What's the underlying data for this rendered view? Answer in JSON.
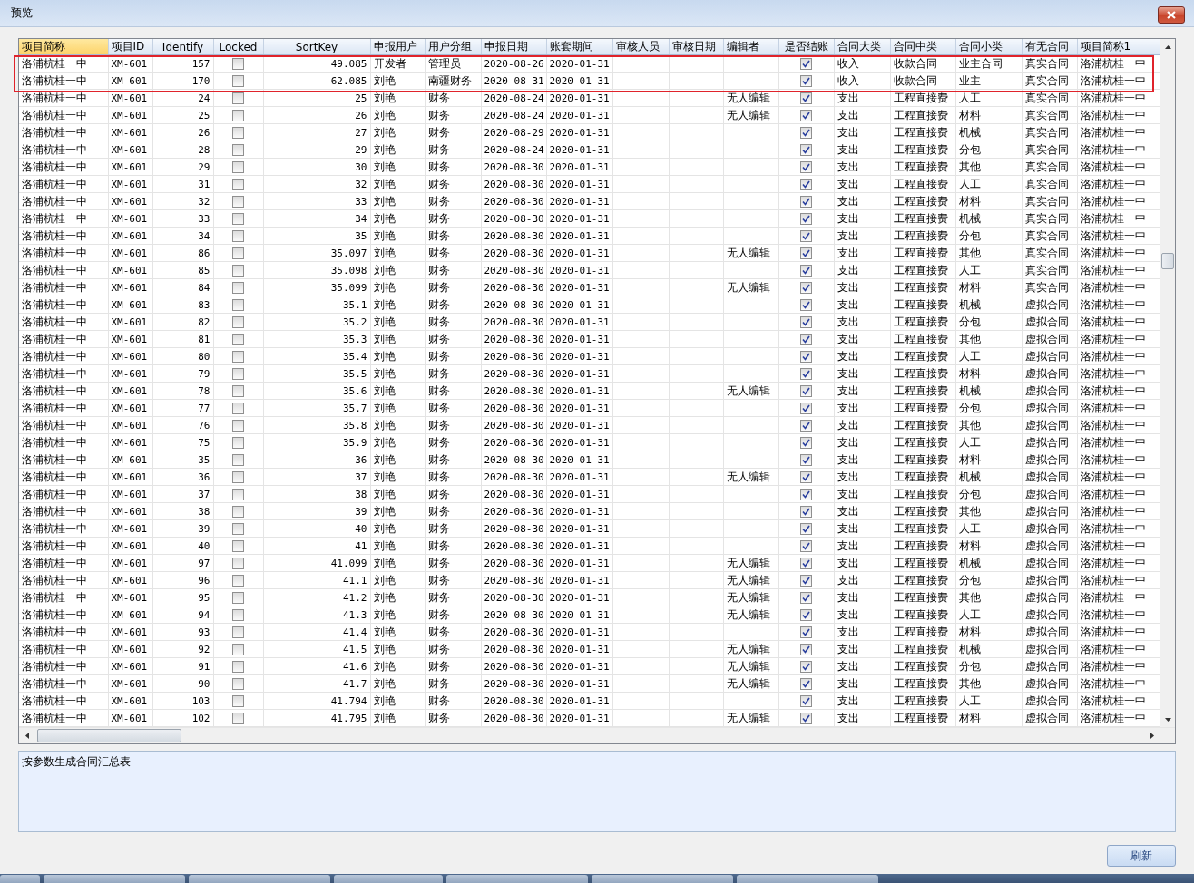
{
  "window": {
    "title": "预览"
  },
  "table": {
    "columns": [
      {
        "label": "项目简称",
        "kind": "text",
        "selected": true
      },
      {
        "label": "项目ID",
        "kind": "code",
        "selected": false
      },
      {
        "label": "Identify",
        "kind": "num",
        "selected": false
      },
      {
        "label": "Locked",
        "kind": "check",
        "selected": false
      },
      {
        "label": "SortKey",
        "kind": "num",
        "selected": false
      },
      {
        "label": "申报用户",
        "kind": "text",
        "selected": false
      },
      {
        "label": "用户分组",
        "kind": "text",
        "selected": false
      },
      {
        "label": "申报日期",
        "kind": "code",
        "selected": false
      },
      {
        "label": "账套期间",
        "kind": "code",
        "selected": false
      },
      {
        "label": "审核人员",
        "kind": "text",
        "selected": false
      },
      {
        "label": "审核日期",
        "kind": "text",
        "selected": false
      },
      {
        "label": "编辑者",
        "kind": "text",
        "selected": false
      },
      {
        "label": "是否结账",
        "kind": "check",
        "selected": false
      },
      {
        "label": "合同大类",
        "kind": "text",
        "selected": false
      },
      {
        "label": "合同中类",
        "kind": "text",
        "selected": false
      },
      {
        "label": "合同小类",
        "kind": "text",
        "selected": false
      },
      {
        "label": "有无合同",
        "kind": "text",
        "selected": false
      },
      {
        "label": "项目简称1",
        "kind": "text",
        "selected": false
      }
    ],
    "rows": [
      {
        "highlighted": true,
        "cells": [
          "洛浦杭桂一中",
          "XM-601",
          "157",
          false,
          "49.085",
          "开发者",
          "管理员",
          "2020-08-26",
          "2020-01-31",
          null,
          null,
          null,
          true,
          "收入",
          "收款合同",
          "业主合同",
          "真实合同",
          "洛浦杭桂一中"
        ]
      },
      {
        "highlighted": true,
        "cells": [
          "洛浦杭桂一中",
          "XM-601",
          "170",
          false,
          "62.085",
          "刘艳",
          "南疆财务",
          "2020-08-31",
          "2020-01-31",
          null,
          null,
          null,
          true,
          "收入",
          "收款合同",
          "业主",
          "真实合同",
          "洛浦杭桂一中"
        ]
      },
      {
        "highlighted": false,
        "cells": [
          "洛浦杭桂一中",
          "XM-601",
          "24",
          false,
          "25",
          "刘艳",
          "财务",
          "2020-08-24",
          "2020-01-31",
          null,
          null,
          "无人编辑",
          true,
          "支出",
          "工程直接费",
          "人工",
          "真实合同",
          "洛浦杭桂一中"
        ]
      },
      {
        "highlighted": false,
        "cells": [
          "洛浦杭桂一中",
          "XM-601",
          "25",
          false,
          "26",
          "刘艳",
          "财务",
          "2020-08-24",
          "2020-01-31",
          null,
          null,
          "无人编辑",
          true,
          "支出",
          "工程直接费",
          "材料",
          "真实合同",
          "洛浦杭桂一中"
        ]
      },
      {
        "highlighted": false,
        "cells": [
          "洛浦杭桂一中",
          "XM-601",
          "26",
          false,
          "27",
          "刘艳",
          "财务",
          "2020-08-29",
          "2020-01-31",
          null,
          null,
          null,
          true,
          "支出",
          "工程直接费",
          "机械",
          "真实合同",
          "洛浦杭桂一中"
        ]
      },
      {
        "highlighted": false,
        "cells": [
          "洛浦杭桂一中",
          "XM-601",
          "28",
          false,
          "29",
          "刘艳",
          "财务",
          "2020-08-24",
          "2020-01-31",
          null,
          null,
          null,
          true,
          "支出",
          "工程直接费",
          "分包",
          "真实合同",
          "洛浦杭桂一中"
        ]
      },
      {
        "highlighted": false,
        "cells": [
          "洛浦杭桂一中",
          "XM-601",
          "29",
          false,
          "30",
          "刘艳",
          "财务",
          "2020-08-30",
          "2020-01-31",
          null,
          null,
          null,
          true,
          "支出",
          "工程直接费",
          "其他",
          "真实合同",
          "洛浦杭桂一中"
        ]
      },
      {
        "highlighted": false,
        "cells": [
          "洛浦杭桂一中",
          "XM-601",
          "31",
          false,
          "32",
          "刘艳",
          "财务",
          "2020-08-30",
          "2020-01-31",
          null,
          null,
          null,
          true,
          "支出",
          "工程直接费",
          "人工",
          "真实合同",
          "洛浦杭桂一中"
        ]
      },
      {
        "highlighted": false,
        "cells": [
          "洛浦杭桂一中",
          "XM-601",
          "32",
          false,
          "33",
          "刘艳",
          "财务",
          "2020-08-30",
          "2020-01-31",
          null,
          null,
          null,
          true,
          "支出",
          "工程直接费",
          "材料",
          "真实合同",
          "洛浦杭桂一中"
        ]
      },
      {
        "highlighted": false,
        "cells": [
          "洛浦杭桂一中",
          "XM-601",
          "33",
          false,
          "34",
          "刘艳",
          "财务",
          "2020-08-30",
          "2020-01-31",
          null,
          null,
          null,
          true,
          "支出",
          "工程直接费",
          "机械",
          "真实合同",
          "洛浦杭桂一中"
        ]
      },
      {
        "highlighted": false,
        "cells": [
          "洛浦杭桂一中",
          "XM-601",
          "34",
          false,
          "35",
          "刘艳",
          "财务",
          "2020-08-30",
          "2020-01-31",
          null,
          null,
          null,
          true,
          "支出",
          "工程直接费",
          "分包",
          "真实合同",
          "洛浦杭桂一中"
        ]
      },
      {
        "highlighted": false,
        "cells": [
          "洛浦杭桂一中",
          "XM-601",
          "86",
          false,
          "35.097",
          "刘艳",
          "财务",
          "2020-08-30",
          "2020-01-31",
          null,
          null,
          "无人编辑",
          true,
          "支出",
          "工程直接费",
          "其他",
          "真实合同",
          "洛浦杭桂一中"
        ]
      },
      {
        "highlighted": false,
        "cells": [
          "洛浦杭桂一中",
          "XM-601",
          "85",
          false,
          "35.098",
          "刘艳",
          "财务",
          "2020-08-30",
          "2020-01-31",
          null,
          null,
          null,
          true,
          "支出",
          "工程直接费",
          "人工",
          "真实合同",
          "洛浦杭桂一中"
        ]
      },
      {
        "highlighted": false,
        "cells": [
          "洛浦杭桂一中",
          "XM-601",
          "84",
          false,
          "35.099",
          "刘艳",
          "财务",
          "2020-08-30",
          "2020-01-31",
          null,
          null,
          "无人编辑",
          true,
          "支出",
          "工程直接费",
          "材料",
          "真实合同",
          "洛浦杭桂一中"
        ]
      },
      {
        "highlighted": false,
        "cells": [
          "洛浦杭桂一中",
          "XM-601",
          "83",
          false,
          "35.1",
          "刘艳",
          "财务",
          "2020-08-30",
          "2020-01-31",
          null,
          null,
          null,
          true,
          "支出",
          "工程直接费",
          "机械",
          "虚拟合同",
          "洛浦杭桂一中"
        ]
      },
      {
        "highlighted": false,
        "cells": [
          "洛浦杭桂一中",
          "XM-601",
          "82",
          false,
          "35.2",
          "刘艳",
          "财务",
          "2020-08-30",
          "2020-01-31",
          null,
          null,
          null,
          true,
          "支出",
          "工程直接费",
          "分包",
          "虚拟合同",
          "洛浦杭桂一中"
        ]
      },
      {
        "highlighted": false,
        "cells": [
          "洛浦杭桂一中",
          "XM-601",
          "81",
          false,
          "35.3",
          "刘艳",
          "财务",
          "2020-08-30",
          "2020-01-31",
          null,
          null,
          null,
          true,
          "支出",
          "工程直接费",
          "其他",
          "虚拟合同",
          "洛浦杭桂一中"
        ]
      },
      {
        "highlighted": false,
        "cells": [
          "洛浦杭桂一中",
          "XM-601",
          "80",
          false,
          "35.4",
          "刘艳",
          "财务",
          "2020-08-30",
          "2020-01-31",
          null,
          null,
          null,
          true,
          "支出",
          "工程直接费",
          "人工",
          "虚拟合同",
          "洛浦杭桂一中"
        ]
      },
      {
        "highlighted": false,
        "cells": [
          "洛浦杭桂一中",
          "XM-601",
          "79",
          false,
          "35.5",
          "刘艳",
          "财务",
          "2020-08-30",
          "2020-01-31",
          null,
          null,
          null,
          true,
          "支出",
          "工程直接费",
          "材料",
          "虚拟合同",
          "洛浦杭桂一中"
        ]
      },
      {
        "highlighted": false,
        "cells": [
          "洛浦杭桂一中",
          "XM-601",
          "78",
          false,
          "35.6",
          "刘艳",
          "财务",
          "2020-08-30",
          "2020-01-31",
          null,
          null,
          "无人编辑",
          true,
          "支出",
          "工程直接费",
          "机械",
          "虚拟合同",
          "洛浦杭桂一中"
        ]
      },
      {
        "highlighted": false,
        "cells": [
          "洛浦杭桂一中",
          "XM-601",
          "77",
          false,
          "35.7",
          "刘艳",
          "财务",
          "2020-08-30",
          "2020-01-31",
          null,
          null,
          null,
          true,
          "支出",
          "工程直接费",
          "分包",
          "虚拟合同",
          "洛浦杭桂一中"
        ]
      },
      {
        "highlighted": false,
        "cells": [
          "洛浦杭桂一中",
          "XM-601",
          "76",
          false,
          "35.8",
          "刘艳",
          "财务",
          "2020-08-30",
          "2020-01-31",
          null,
          null,
          null,
          true,
          "支出",
          "工程直接费",
          "其他",
          "虚拟合同",
          "洛浦杭桂一中"
        ]
      },
      {
        "highlighted": false,
        "cells": [
          "洛浦杭桂一中",
          "XM-601",
          "75",
          false,
          "35.9",
          "刘艳",
          "财务",
          "2020-08-30",
          "2020-01-31",
          null,
          null,
          null,
          true,
          "支出",
          "工程直接费",
          "人工",
          "虚拟合同",
          "洛浦杭桂一中"
        ]
      },
      {
        "highlighted": false,
        "cells": [
          "洛浦杭桂一中",
          "XM-601",
          "35",
          false,
          "36",
          "刘艳",
          "财务",
          "2020-08-30",
          "2020-01-31",
          null,
          null,
          null,
          true,
          "支出",
          "工程直接费",
          "材料",
          "虚拟合同",
          "洛浦杭桂一中"
        ]
      },
      {
        "highlighted": false,
        "cells": [
          "洛浦杭桂一中",
          "XM-601",
          "36",
          false,
          "37",
          "刘艳",
          "财务",
          "2020-08-30",
          "2020-01-31",
          null,
          null,
          "无人编辑",
          true,
          "支出",
          "工程直接费",
          "机械",
          "虚拟合同",
          "洛浦杭桂一中"
        ]
      },
      {
        "highlighted": false,
        "cells": [
          "洛浦杭桂一中",
          "XM-601",
          "37",
          false,
          "38",
          "刘艳",
          "财务",
          "2020-08-30",
          "2020-01-31",
          null,
          null,
          null,
          true,
          "支出",
          "工程直接费",
          "分包",
          "虚拟合同",
          "洛浦杭桂一中"
        ]
      },
      {
        "highlighted": false,
        "cells": [
          "洛浦杭桂一中",
          "XM-601",
          "38",
          false,
          "39",
          "刘艳",
          "财务",
          "2020-08-30",
          "2020-01-31",
          null,
          null,
          null,
          true,
          "支出",
          "工程直接费",
          "其他",
          "虚拟合同",
          "洛浦杭桂一中"
        ]
      },
      {
        "highlighted": false,
        "cells": [
          "洛浦杭桂一中",
          "XM-601",
          "39",
          false,
          "40",
          "刘艳",
          "财务",
          "2020-08-30",
          "2020-01-31",
          null,
          null,
          null,
          true,
          "支出",
          "工程直接费",
          "人工",
          "虚拟合同",
          "洛浦杭桂一中"
        ]
      },
      {
        "highlighted": false,
        "cells": [
          "洛浦杭桂一中",
          "XM-601",
          "40",
          false,
          "41",
          "刘艳",
          "财务",
          "2020-08-30",
          "2020-01-31",
          null,
          null,
          null,
          true,
          "支出",
          "工程直接费",
          "材料",
          "虚拟合同",
          "洛浦杭桂一中"
        ]
      },
      {
        "highlighted": false,
        "cells": [
          "洛浦杭桂一中",
          "XM-601",
          "97",
          false,
          "41.099",
          "刘艳",
          "财务",
          "2020-08-30",
          "2020-01-31",
          null,
          null,
          "无人编辑",
          true,
          "支出",
          "工程直接费",
          "机械",
          "虚拟合同",
          "洛浦杭桂一中"
        ]
      },
      {
        "highlighted": false,
        "cells": [
          "洛浦杭桂一中",
          "XM-601",
          "96",
          false,
          "41.1",
          "刘艳",
          "财务",
          "2020-08-30",
          "2020-01-31",
          null,
          null,
          "无人编辑",
          true,
          "支出",
          "工程直接费",
          "分包",
          "虚拟合同",
          "洛浦杭桂一中"
        ]
      },
      {
        "highlighted": false,
        "cells": [
          "洛浦杭桂一中",
          "XM-601",
          "95",
          false,
          "41.2",
          "刘艳",
          "财务",
          "2020-08-30",
          "2020-01-31",
          null,
          null,
          "无人编辑",
          true,
          "支出",
          "工程直接费",
          "其他",
          "虚拟合同",
          "洛浦杭桂一中"
        ]
      },
      {
        "highlighted": false,
        "cells": [
          "洛浦杭桂一中",
          "XM-601",
          "94",
          false,
          "41.3",
          "刘艳",
          "财务",
          "2020-08-30",
          "2020-01-31",
          null,
          null,
          "无人编辑",
          true,
          "支出",
          "工程直接费",
          "人工",
          "虚拟合同",
          "洛浦杭桂一中"
        ]
      },
      {
        "highlighted": false,
        "cells": [
          "洛浦杭桂一中",
          "XM-601",
          "93",
          false,
          "41.4",
          "刘艳",
          "财务",
          "2020-08-30",
          "2020-01-31",
          null,
          null,
          null,
          true,
          "支出",
          "工程直接费",
          "材料",
          "虚拟合同",
          "洛浦杭桂一中"
        ]
      },
      {
        "highlighted": false,
        "cells": [
          "洛浦杭桂一中",
          "XM-601",
          "92",
          false,
          "41.5",
          "刘艳",
          "财务",
          "2020-08-30",
          "2020-01-31",
          null,
          null,
          "无人编辑",
          true,
          "支出",
          "工程直接费",
          "机械",
          "虚拟合同",
          "洛浦杭桂一中"
        ]
      },
      {
        "highlighted": false,
        "cells": [
          "洛浦杭桂一中",
          "XM-601",
          "91",
          false,
          "41.6",
          "刘艳",
          "财务",
          "2020-08-30",
          "2020-01-31",
          null,
          null,
          "无人编辑",
          true,
          "支出",
          "工程直接费",
          "分包",
          "虚拟合同",
          "洛浦杭桂一中"
        ]
      },
      {
        "highlighted": false,
        "cells": [
          "洛浦杭桂一中",
          "XM-601",
          "90",
          false,
          "41.7",
          "刘艳",
          "财务",
          "2020-08-30",
          "2020-01-31",
          null,
          null,
          "无人编辑",
          true,
          "支出",
          "工程直接费",
          "其他",
          "虚拟合同",
          "洛浦杭桂一中"
        ]
      },
      {
        "highlighted": false,
        "cells": [
          "洛浦杭桂一中",
          "XM-601",
          "103",
          false,
          "41.794",
          "刘艳",
          "财务",
          "2020-08-30",
          "2020-01-31",
          null,
          null,
          null,
          true,
          "支出",
          "工程直接费",
          "人工",
          "虚拟合同",
          "洛浦杭桂一中"
        ]
      },
      {
        "highlighted": false,
        "cells": [
          "洛浦杭桂一中",
          "XM-601",
          "102",
          false,
          "41.795",
          "刘艳",
          "财务",
          "2020-08-30",
          "2020-01-31",
          null,
          null,
          "无人编辑",
          true,
          "支出",
          "工程直接费",
          "材料",
          "虚拟合同",
          "洛浦杭桂一中"
        ]
      }
    ]
  },
  "memo": {
    "value": "按参数生成合同汇总表"
  },
  "buttons": [
    {
      "label": "刷新"
    }
  ]
}
